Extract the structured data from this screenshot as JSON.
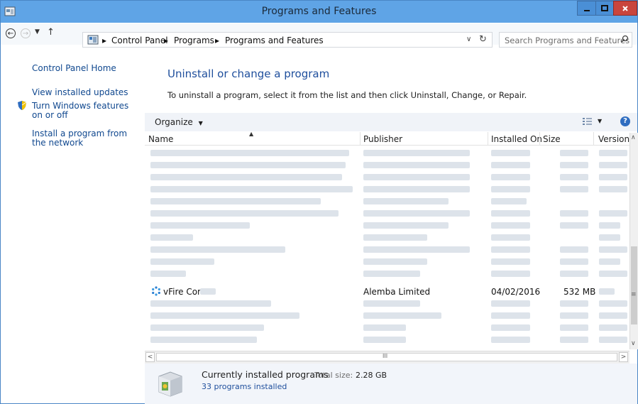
{
  "window": {
    "title": "Programs and Features",
    "controls": {
      "minimize": "–",
      "maximize": "□",
      "close": "x"
    }
  },
  "address": {
    "breadcrumbs": [
      "Control Panel",
      "Programs",
      "Programs and Features"
    ],
    "search_placeholder": "Search Programs and Features"
  },
  "sidebar": {
    "home": "Control Panel Home",
    "links": [
      {
        "label": "View installed updates"
      },
      {
        "label": "Turn Windows features on or off",
        "shield": true
      },
      {
        "label": "Install a program from the network"
      }
    ]
  },
  "main": {
    "heading": "Uninstall or change a program",
    "instructions": "To uninstall a program, select it from the list and then click Uninstall, Change, or Repair.",
    "organize_label": "Organize",
    "columns": [
      "Name",
      "Publisher",
      "Installed On",
      "Size",
      "Version"
    ],
    "visible_program": {
      "name": "vFire Core",
      "publisher": "Alemba Limited",
      "installed_on": "04/02/2016",
      "size": "532 MB"
    }
  },
  "details": {
    "title": "Currently installed programs",
    "total_label": "Total size:",
    "total_value": "2.28 GB",
    "count_text": "33 programs installed"
  },
  "icons": [
    "window-icon",
    "back-icon",
    "forward-icon",
    "up-icon",
    "control-panel-icon",
    "refresh-icon",
    "search-icon",
    "shield-icon",
    "view-icon",
    "help-icon",
    "vfire-icon",
    "installer-box-icon"
  ],
  "colors": {
    "titlebar": "#5fa4e6",
    "link": "#10488f",
    "heading": "#1e4e9c",
    "close": "#c9453d"
  }
}
